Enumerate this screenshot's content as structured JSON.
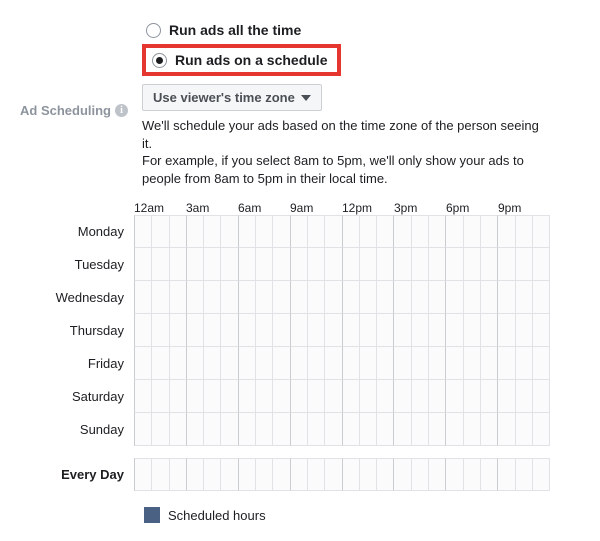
{
  "label": "Ad Scheduling",
  "radios": {
    "all_time": "Run ads all the time",
    "schedule": "Run ads on a schedule"
  },
  "timezone_dropdown": "Use viewer's time zone",
  "help_line1": "We'll schedule your ads based on the time zone of the person seeing it.",
  "help_line2": "For example, if you select 8am to 5pm, we'll only show your ads to people from 8am to 5pm in their local time.",
  "time_headers": [
    "12am",
    "3am",
    "6am",
    "9am",
    "12pm",
    "3pm",
    "6pm",
    "9pm"
  ],
  "days": [
    "Monday",
    "Tuesday",
    "Wednesday",
    "Thursday",
    "Friday",
    "Saturday",
    "Sunday"
  ],
  "every_day": "Every Day",
  "legend": "Scheduled hours"
}
